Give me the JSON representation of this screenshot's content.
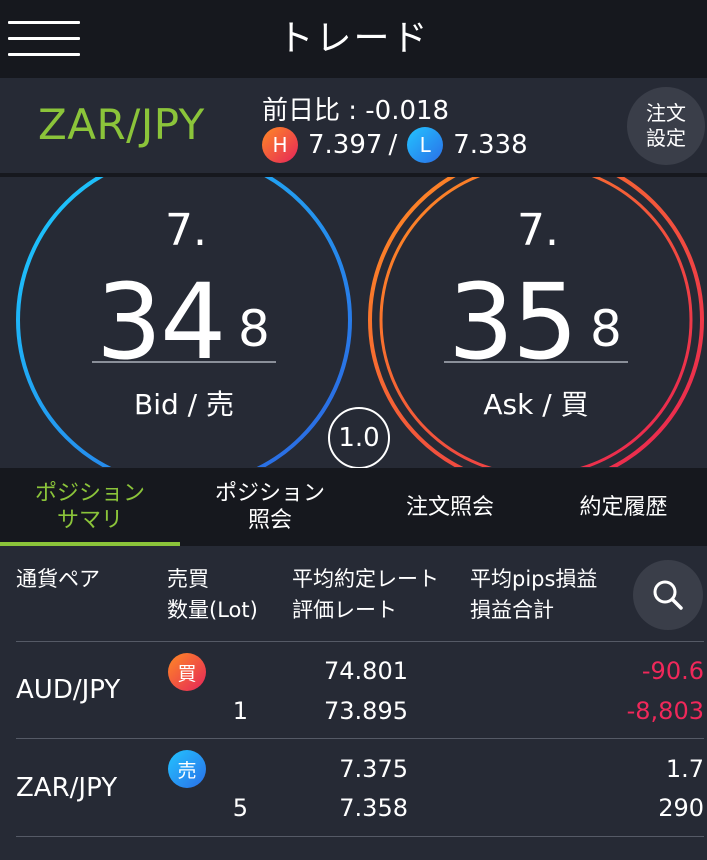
{
  "header": {
    "title": "トレード"
  },
  "pair": {
    "name": "ZAR/JPY",
    "change": "前日比 : -0.018",
    "high_badge": "H",
    "high": "7.397",
    "low_badge": "L",
    "low": "7.338",
    "order_settings": [
      "注文",
      "設定"
    ]
  },
  "bid": {
    "prefix": "7.",
    "big": "34",
    "small": "8",
    "label": "Bid / 売"
  },
  "ask": {
    "prefix": "7.",
    "big": "35",
    "small": "8",
    "label": "Ask / 買"
  },
  "lot": "1.0",
  "tabs": [
    {
      "label": [
        "ポジション",
        "サマリ"
      ],
      "active": true
    },
    {
      "label": [
        "ポジション",
        "照会"
      ],
      "active": false
    },
    {
      "label": [
        "注文照会"
      ],
      "active": false
    },
    {
      "label": [
        "約定履歴"
      ],
      "active": false
    }
  ],
  "table": {
    "headers": {
      "pair": "通貨ペア",
      "side": "売買",
      "qty": "数量(Lot)",
      "avg_rate": "平均約定レート",
      "eval_rate": "評価レート",
      "avg_pips": "平均pips損益",
      "pnl_total": "損益合計"
    },
    "rows": [
      {
        "pair": "AUD/JPY",
        "side": "買",
        "qty": "1",
        "avg_rate": "74.801",
        "eval_rate": "73.895",
        "pips": "-90.6",
        "pnl": "-8,803",
        "negative": true
      },
      {
        "pair": "ZAR/JPY",
        "side": "売",
        "qty": "5",
        "avg_rate": "7.375",
        "eval_rate": "7.358",
        "pips": "1.7",
        "pnl": "290",
        "negative": false
      }
    ]
  },
  "colors": {
    "accent": "#8bc43a",
    "negative": "#f0285a",
    "buy_gradient": [
      "#ff8a24",
      "#e5245a"
    ],
    "sell_gradient": [
      "#23c4ff",
      "#2a6ee8"
    ],
    "header_bg": "#16181e",
    "panel_bg": "#262a35"
  }
}
